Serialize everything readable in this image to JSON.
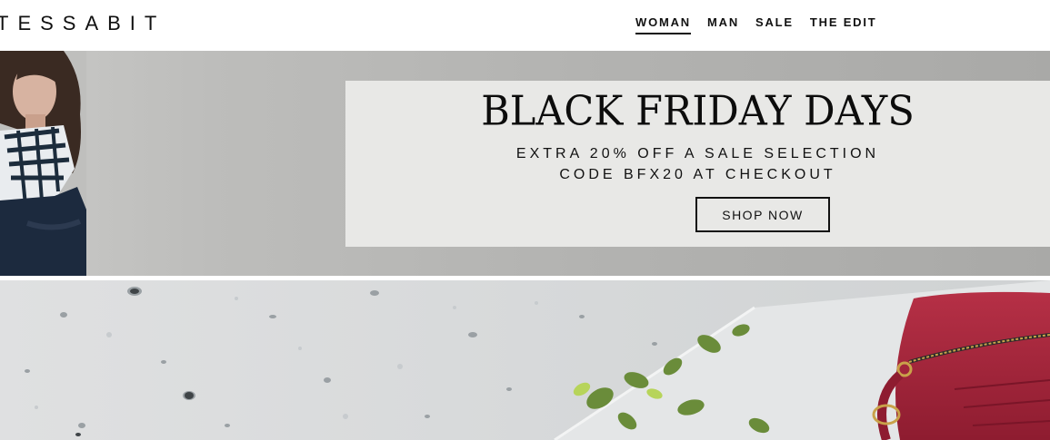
{
  "header": {
    "logo": "TESSABIT",
    "nav": [
      {
        "label": "WOMAN",
        "active": true
      },
      {
        "label": "MAN",
        "active": false
      },
      {
        "label": "SALE",
        "active": false
      },
      {
        "label": "THE EDIT",
        "active": false
      }
    ]
  },
  "hero": {
    "title": "BLACK FRIDAY DAYS",
    "line1": "EXTRA 20% OFF A SALE SELECTION",
    "line2": "CODE BFX20 AT CHECKOUT",
    "cta": "SHOP NOW",
    "box_color": "#e8e8e6"
  },
  "colors": {
    "text": "#111111",
    "hero_bg": "#b3b3b1",
    "bag": "#a3233a"
  }
}
